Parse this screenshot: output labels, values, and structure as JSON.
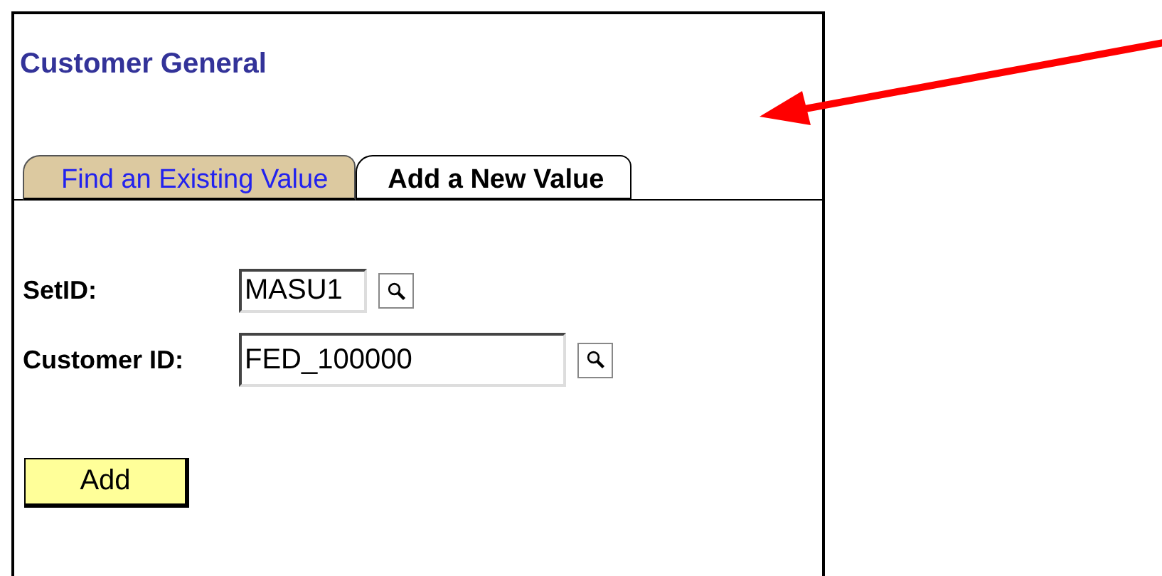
{
  "page": {
    "title": "Customer General"
  },
  "tabs": [
    {
      "label": "Find an Existing Value",
      "selected": false
    },
    {
      "label": "Add a New Value",
      "selected": true
    }
  ],
  "fields": [
    {
      "label": "SetID:",
      "value": "MASU1"
    },
    {
      "label": "Customer ID:",
      "value": "FED_100000"
    }
  ],
  "buttons": [
    "Add"
  ]
}
